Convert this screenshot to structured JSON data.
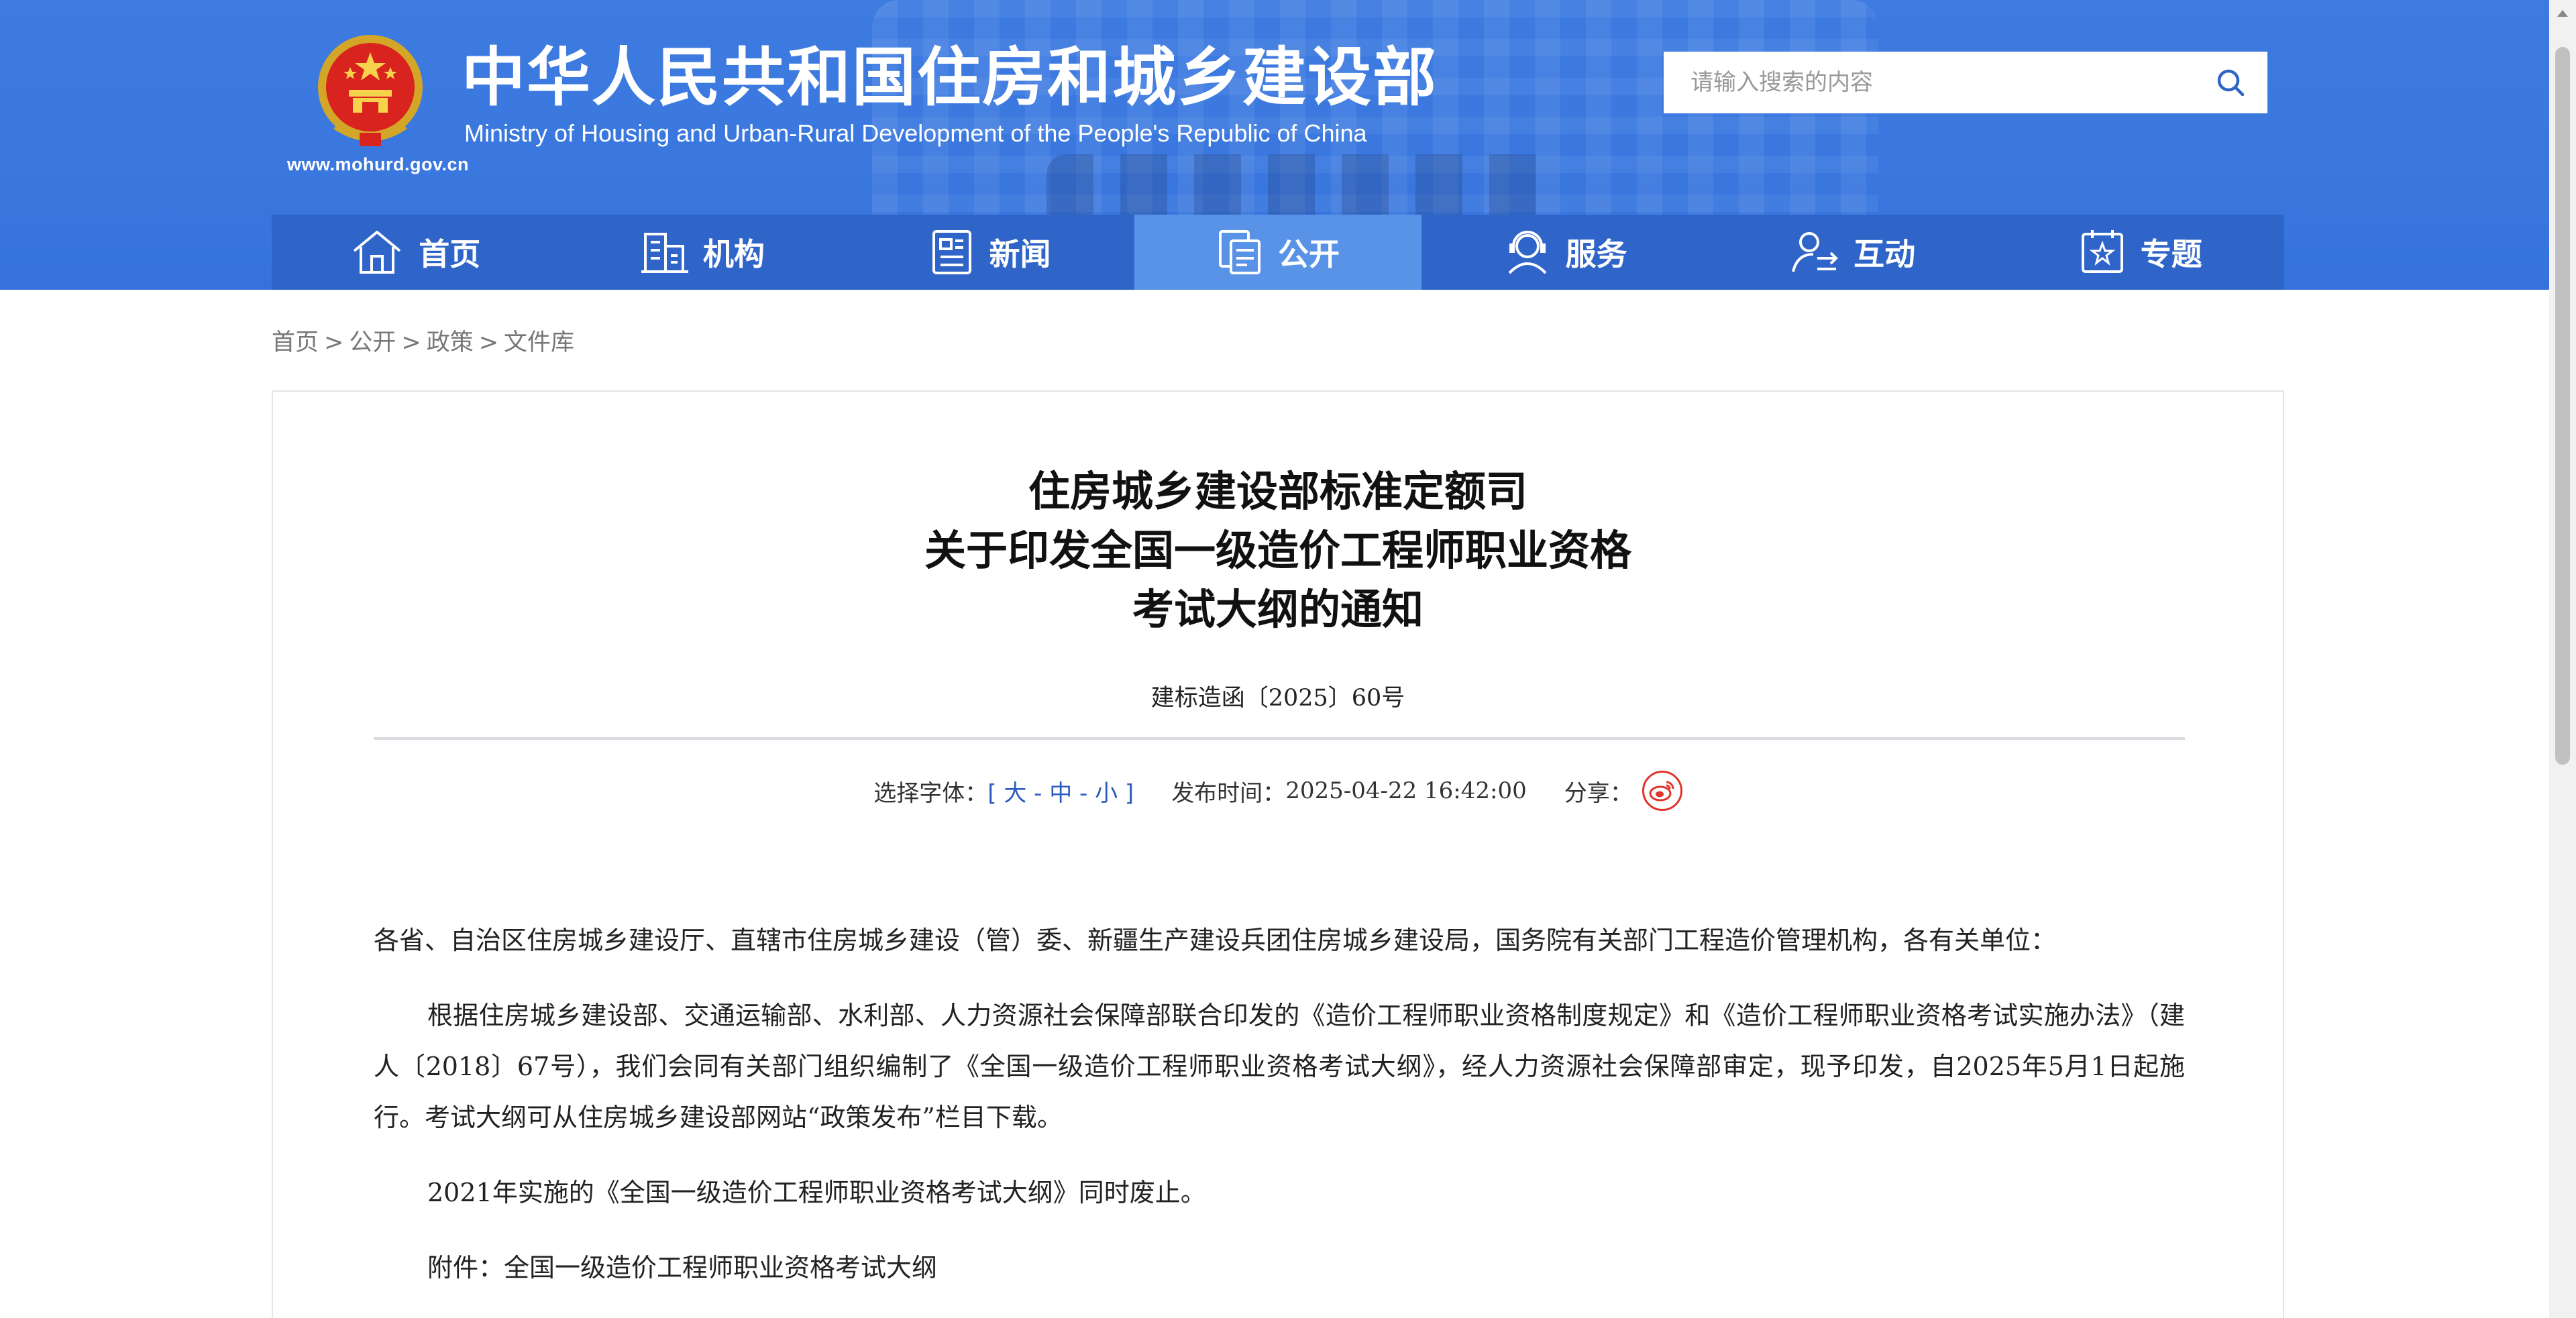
{
  "header": {
    "title_cn": "中华人民共和国住房和城乡建设部",
    "title_en": "Ministry of Housing and Urban-Rural Development of the People's Republic of China",
    "site_url": "www.mohurd.gov.cn",
    "emblem_icon": "national-emblem-icon"
  },
  "search": {
    "placeholder": "请输入搜索的内容",
    "icon": "search-icon"
  },
  "nav": {
    "items": [
      {
        "label": "首页",
        "icon": "home-icon"
      },
      {
        "label": "机构",
        "icon": "building-icon"
      },
      {
        "label": "新闻",
        "icon": "news-icon"
      },
      {
        "label": "公开",
        "icon": "document-icon",
        "active": true
      },
      {
        "label": "服务",
        "icon": "service-icon"
      },
      {
        "label": "互动",
        "icon": "interact-icon"
      },
      {
        "label": "专题",
        "icon": "topic-icon"
      }
    ]
  },
  "breadcrumb": {
    "items": [
      "首页",
      "公开",
      "政策",
      "文件库"
    ],
    "separator": ">"
  },
  "article": {
    "title_line1": "住房城乡建设部标准定额司",
    "title_line2": "关于印发全国一级造价工程师职业资格",
    "title_line3": "考试大纲的通知",
    "doc_number": "建标造函〔2025〕60号",
    "font_select_label": "选择字体：",
    "font_large": "大",
    "font_medium": "中",
    "font_small": "小",
    "publish_label": "发布时间：",
    "publish_time": "2025-04-22 16:42:00",
    "share_label": "分享：",
    "share_icon": "weibo-icon",
    "paragraphs": [
      "各省、自治区住房城乡建设厅、直辖市住房城乡建设（管）委、新疆生产建设兵团住房城乡建设局，国务院有关部门工程造价管理机构，各有关单位：",
      "根据住房城乡建设部、交通运输部、水利部、人力资源社会保障部联合印发的《造价工程师职业资格制度规定》和《造价工程师职业资格考试实施办法》（建人〔2018〕67号），我们会同有关部门组织编制了《全国一级造价工程师职业资格考试大纲》，经人力资源社会保障部审定，现予印发，自2025年5月1日起施行。考试大纲可从住房城乡建设部网站“政策发布”栏目下载。",
      "2021年实施的《全国一级造价工程师职业资格考试大纲》同时废止。",
      "附件：全国一级造价工程师职业资格考试大纲"
    ]
  },
  "colors": {
    "header_blue": "#3a78df",
    "nav_blue": "#2f65c8",
    "nav_active": "#5993e8",
    "link_blue": "#2a5cbf",
    "weibo_red": "#e0342c"
  }
}
